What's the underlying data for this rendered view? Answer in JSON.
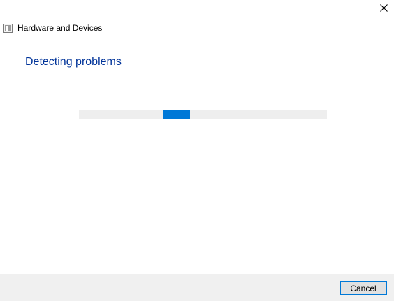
{
  "window": {
    "close_icon": "close-icon"
  },
  "header": {
    "icon": "troubleshooter-icon",
    "title": "Hardware and Devices"
  },
  "main": {
    "heading": "Detecting problems",
    "progress": {
      "style": "indeterminate-marquee",
      "track_color": "#eeeeee",
      "chunk_color": "#0078d7"
    }
  },
  "footer": {
    "cancel_label": "Cancel"
  },
  "colors": {
    "heading": "#003399",
    "accent": "#0078d7",
    "footer_bg": "#f0f0f0"
  }
}
